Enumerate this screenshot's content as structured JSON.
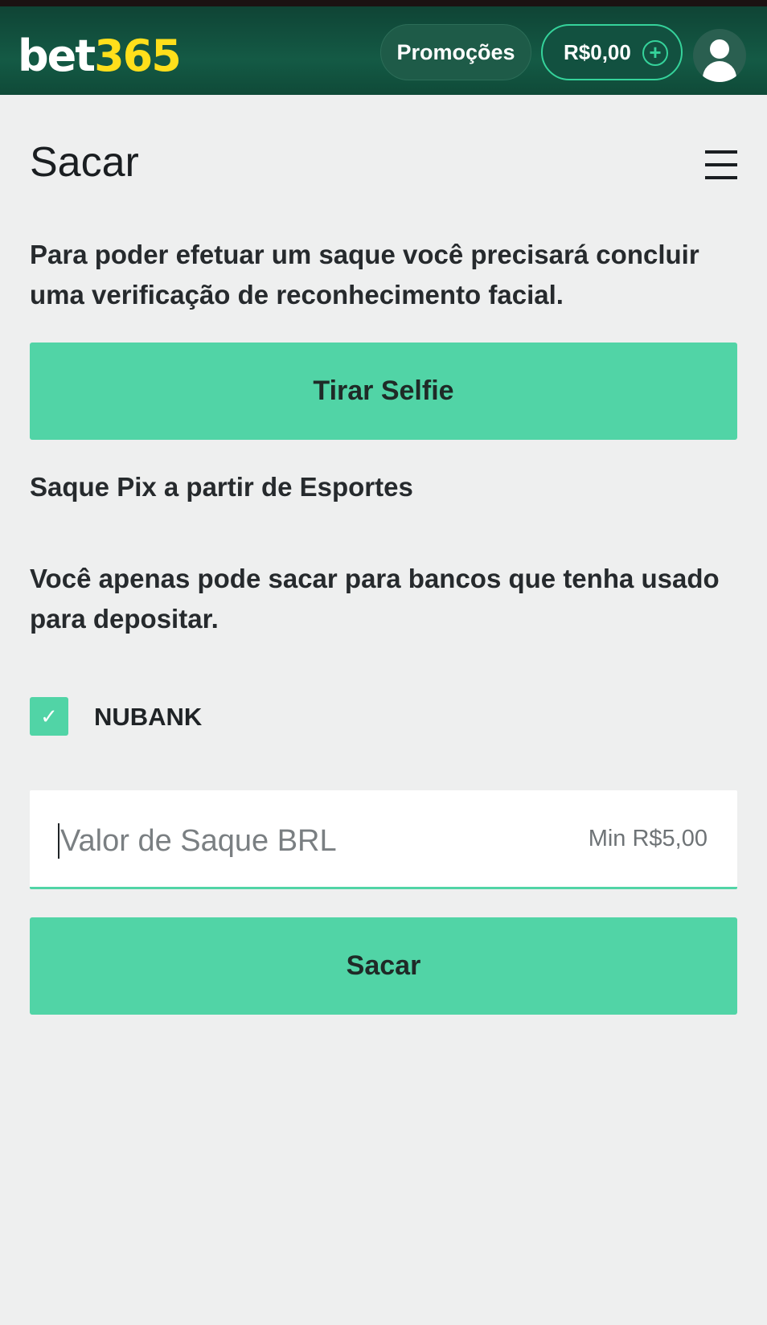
{
  "header": {
    "logo_part1": "bet",
    "logo_part2": "365",
    "promotions_label": "Promoções",
    "balance": "R$0,00",
    "deposit_icon": "plus-circle-icon",
    "account_icon": "user-avatar-icon"
  },
  "page": {
    "title": "Sacar",
    "menu_icon": "hamburger-menu-icon",
    "intro_text": "Para poder efetuar um saque você precisará concluir uma verificação de reconhecimento facial.",
    "selfie_button": "Tirar Selfie",
    "pix_heading": "Saque Pix a partir de Esportes",
    "bank_notice": "Você apenas pode sacar para bancos que tenha usado para depositar.",
    "bank_option": {
      "label": "NUBANK",
      "checked": true
    },
    "amount_field": {
      "placeholder": "Valor de Saque BRL",
      "value": "",
      "min_label": "Min R$5,00"
    },
    "withdraw_button": "Sacar"
  },
  "colors": {
    "header_bg": "#145a45",
    "accent": "#51d4a6",
    "logo_yellow": "#ffdf1b",
    "page_bg": "#eeefef"
  }
}
